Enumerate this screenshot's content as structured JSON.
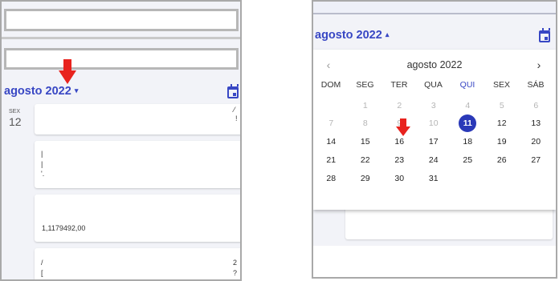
{
  "left_panel": {
    "month_selector": {
      "label": "agosto 2022",
      "caret": "▾"
    },
    "calendar_icon": "calendar-icon",
    "day_group": {
      "weekday": "SEX",
      "day": "12"
    },
    "cards": [
      {
        "fragments": [
          "⁄",
          "!"
        ]
      },
      {
        "fragments": [
          "|",
          "|",
          "'."
        ]
      },
      {
        "fragments": [
          "1,1179492,00"
        ]
      },
      {
        "fragments": [
          "/",
          "[",
          "2",
          "?"
        ]
      }
    ]
  },
  "right_panel": {
    "month_selector": {
      "label": "agosto 2022",
      "caret": "▴"
    },
    "calendar_icon": "calendar-icon",
    "date_picker": {
      "title": "agosto 2022",
      "prev_icon": "‹",
      "next_icon": "›",
      "weekdays": [
        "DOM",
        "SEG",
        "TER",
        "QUA",
        "QUI",
        "SEX",
        "SÁB"
      ],
      "today_weekday_index": 4,
      "weeks": [
        [
          {
            "label": "1",
            "disabled": true
          },
          {
            "label": "2",
            "disabled": true
          },
          {
            "label": "3",
            "disabled": true
          },
          {
            "label": "4",
            "disabled": true
          },
          {
            "label": "5",
            "disabled": true
          },
          {
            "label": "6",
            "disabled": true
          }
        ],
        [
          {
            "label": "7",
            "disabled": true
          },
          {
            "label": "8",
            "disabled": true
          },
          {
            "label": "9",
            "disabled": true
          },
          {
            "label": "10",
            "disabled": true
          },
          {
            "label": "11",
            "selected": true
          },
          {
            "label": "12"
          },
          {
            "label": "13"
          }
        ],
        [
          {
            "label": "14"
          },
          {
            "label": "15"
          },
          {
            "label": "16"
          },
          {
            "label": "17"
          },
          {
            "label": "18"
          },
          {
            "label": "19"
          },
          {
            "label": "20"
          }
        ],
        [
          {
            "label": "21"
          },
          {
            "label": "22"
          },
          {
            "label": "23"
          },
          {
            "label": "24"
          },
          {
            "label": "25"
          },
          {
            "label": "26"
          },
          {
            "label": "27"
          }
        ],
        [
          {
            "label": "28"
          },
          {
            "label": "29"
          },
          {
            "label": "30"
          },
          {
            "label": "31"
          }
        ]
      ]
    }
  },
  "annotations": {
    "arrow_color": "#e8231e",
    "accent_color": "#3847c4",
    "selected_color": "#2a39b8"
  }
}
